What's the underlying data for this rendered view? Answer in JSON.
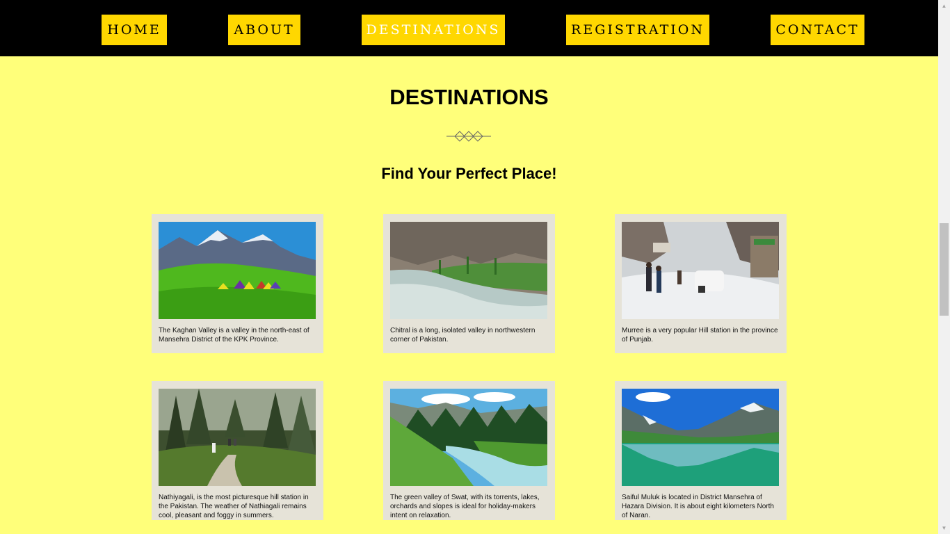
{
  "nav": {
    "items": [
      {
        "label": "HOME",
        "active": false
      },
      {
        "label": "ABOUT",
        "active": false
      },
      {
        "label": "DESTINATIONS",
        "active": true
      },
      {
        "label": "REGISTRATION",
        "active": false
      },
      {
        "label": "CONTACT",
        "active": false
      }
    ]
  },
  "page": {
    "title": "DESTINATIONS",
    "subtitle": "Find Your Perfect Place!"
  },
  "destinations": [
    {
      "image": "kaghan-valley-photo",
      "text": "The Kaghan Valley is a valley in the north-east of Mansehra District of the KPK Province."
    },
    {
      "image": "chitral-valley-photo",
      "text": "Chitral is a long, isolated valley in northwestern corner of Pakistan."
    },
    {
      "image": "murree-snow-photo",
      "text": "Murree is a very popular Hill station in the province of Punjab."
    },
    {
      "image": "nathiagali-forest-photo",
      "text": "Nathiyagali, is the most picturesque hill station in the Pakistan. The weather of Nathiagali remains cool, pleasant and foggy in summers."
    },
    {
      "image": "swat-valley-photo",
      "text": "The green valley of Swat, with its torrents, lakes, orchards and slopes is ideal for holiday-makers intent on relaxation."
    },
    {
      "image": "saiful-muluk-lake-photo",
      "text": "Saiful Muluk is located in District Mansehra of Hazara Division. It is about eight kilometers North of Naran."
    }
  ],
  "colors": {
    "background": "#ffff7a",
    "nav_bar": "#000000",
    "nav_button": "#ffd700",
    "card": "#e6e3d8"
  }
}
